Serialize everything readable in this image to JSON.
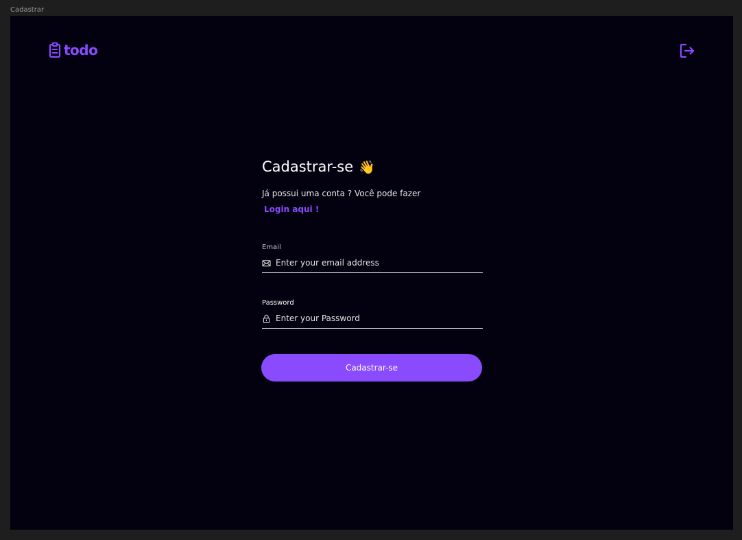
{
  "frame": {
    "label": "Cadastrar"
  },
  "header": {
    "logo_text": "todo",
    "logo_icon": "clipboard-icon",
    "logout_icon": "logout-icon"
  },
  "form": {
    "title": "Cadastrar-se",
    "title_emoji": "👋",
    "subtitle": "Já possui uma conta ? Você pode fazer",
    "login_link": "Login aqui !",
    "email": {
      "label": "Email",
      "placeholder": "Enter your email address",
      "value": ""
    },
    "password": {
      "label": "Password",
      "placeholder": "Enter your Password",
      "value": ""
    },
    "submit_label": "Cadastrar-se"
  },
  "colors": {
    "accent": "#8a4bff",
    "background": "#03010f",
    "canvas": "#1e1e1e"
  }
}
